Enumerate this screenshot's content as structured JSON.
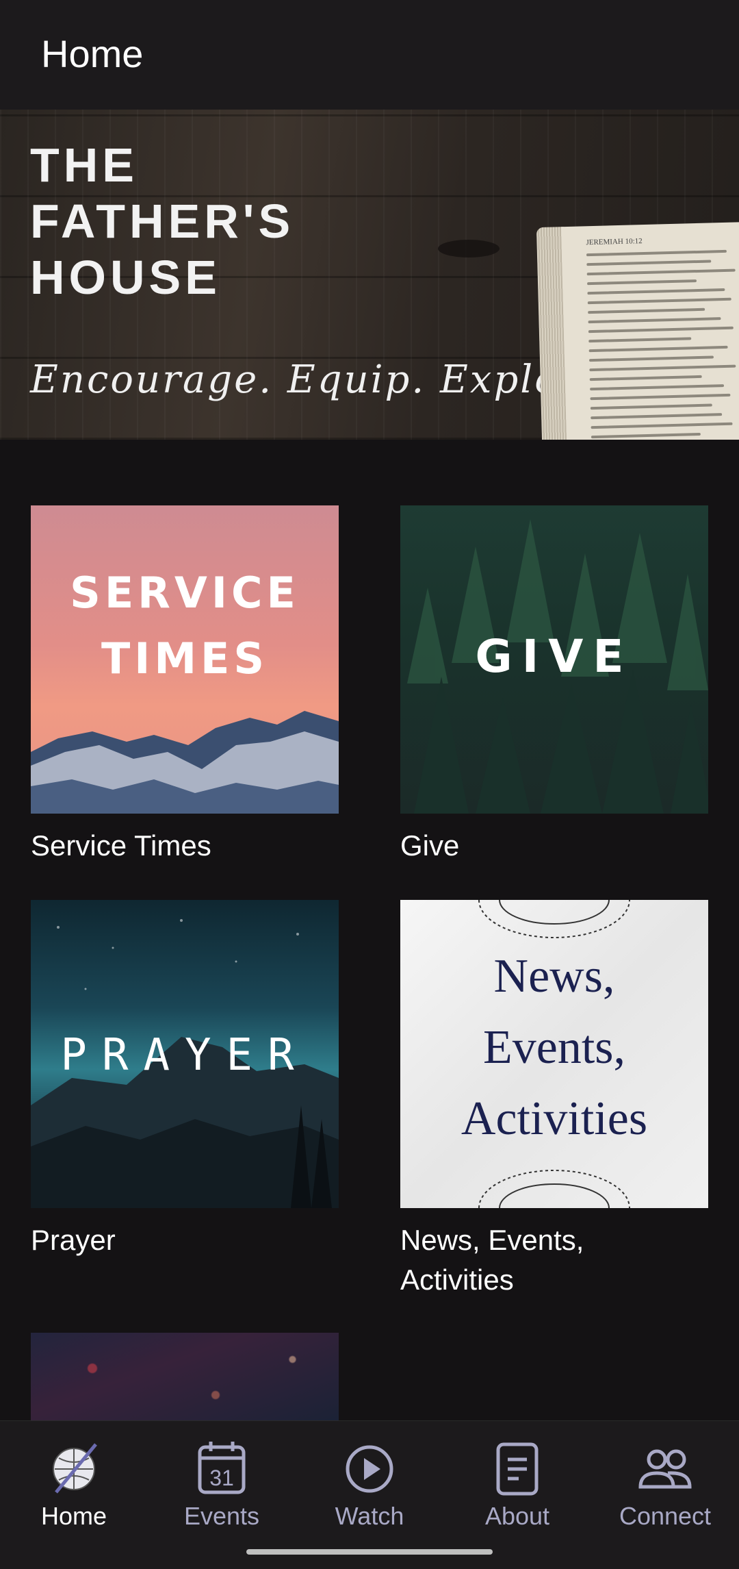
{
  "header": {
    "title": "Home"
  },
  "hero": {
    "title_lines": [
      "THE",
      "FATHER'S",
      "HOUSE"
    ],
    "tagline": "Encourage. Equip. Explore.",
    "bible_header": "JEREMIAH 10:12"
  },
  "tiles": [
    {
      "image_text": [
        "SERVICE",
        "TIMES"
      ],
      "label": "Service Times"
    },
    {
      "image_text": [
        "GIVE"
      ],
      "label": "Give"
    },
    {
      "image_text": [
        "PRAYER"
      ],
      "label": "Prayer"
    },
    {
      "image_text": [
        "News,",
        "Events,",
        "Activities"
      ],
      "label": "News, Events, Activities"
    }
  ],
  "nav": {
    "items": [
      {
        "label": "Home",
        "icon": "globe-logo-icon",
        "active": true
      },
      {
        "label": "Events",
        "icon": "calendar-icon",
        "calendar_day": "31"
      },
      {
        "label": "Watch",
        "icon": "play-circle-icon"
      },
      {
        "label": "About",
        "icon": "document-icon"
      },
      {
        "label": "Connect",
        "icon": "people-icon"
      }
    ]
  },
  "colors": {
    "background": "#141214",
    "bar": "#1c1a1c",
    "nav_inactive": "#a9a9c6",
    "nav_active": "#ffffff"
  }
}
